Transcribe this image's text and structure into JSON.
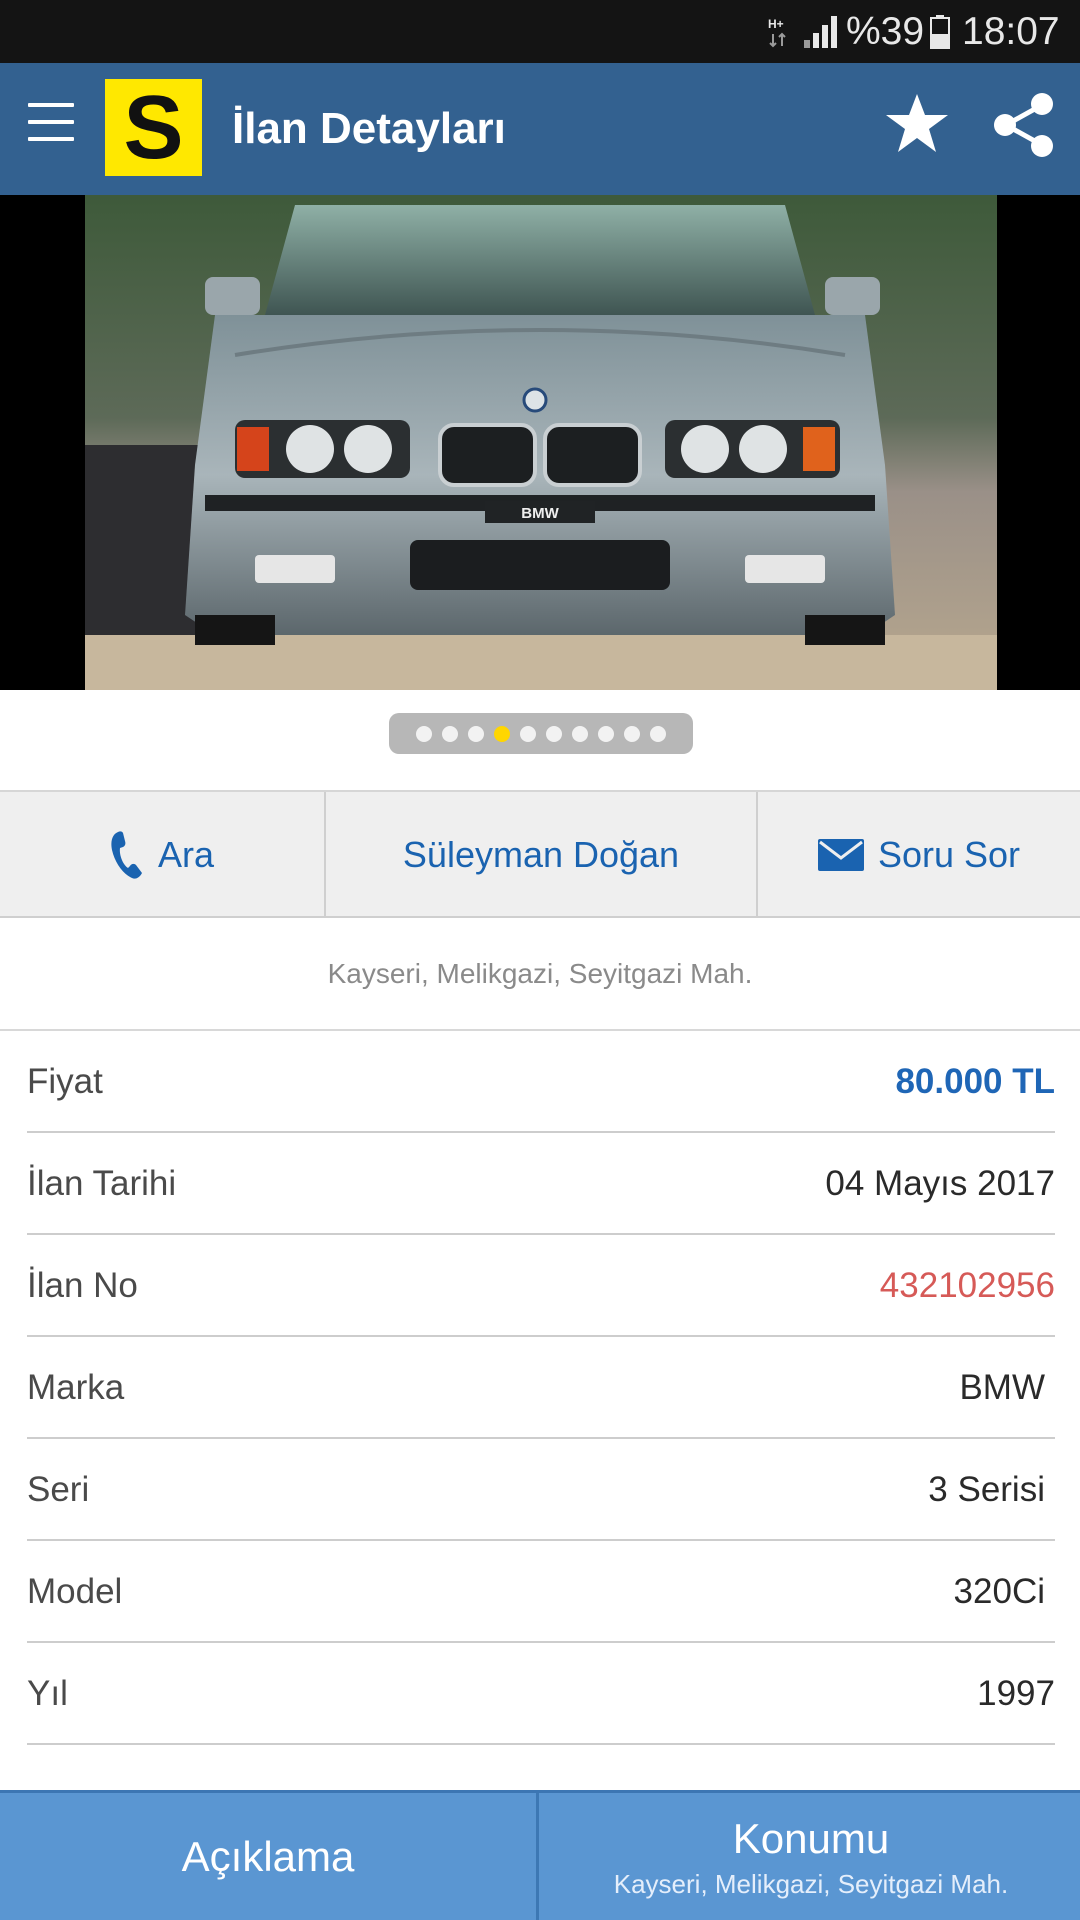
{
  "status_bar": {
    "network": "H+",
    "battery": "%39",
    "time": "18:07"
  },
  "app_bar": {
    "logo_letter": "S",
    "title": "İlan Detayları",
    "icons": [
      "menu-icon",
      "star-icon",
      "share-icon"
    ]
  },
  "gallery": {
    "photo_count": 10,
    "active_index": 3,
    "plate_text": "BMW"
  },
  "actions": {
    "call_label": "Ara",
    "seller_name": "Süleyman Doğan",
    "ask_label": "Soru Sor"
  },
  "location": "Kayseri, Melikgazi, Seyitgazi Mah.",
  "details": [
    {
      "label": "Fiyat",
      "value": "80.000 TL"
    },
    {
      "label": "İlan Tarihi",
      "value": "04 Mayıs 2017"
    },
    {
      "label": "İlan No",
      "value": "432102956"
    },
    {
      "label": "Marka",
      "value": "BMW"
    },
    {
      "label": "Seri",
      "value": "3 Serisi"
    },
    {
      "label": "Model",
      "value": "320Ci"
    },
    {
      "label": "Yıl",
      "value": "1997"
    }
  ],
  "bottom_tabs": {
    "description_label": "Açıklama",
    "location_label": "Konumu",
    "location_sub": "Kayseri, Melikgazi, Seyitgazi Mah."
  },
  "colors": {
    "app_bar": "#336190",
    "logo": "#ffe800",
    "link_blue": "#1a63b0",
    "price": "#1f66b6",
    "listing_no": "#d65a57",
    "bottom_bar": "#5a96d2"
  }
}
